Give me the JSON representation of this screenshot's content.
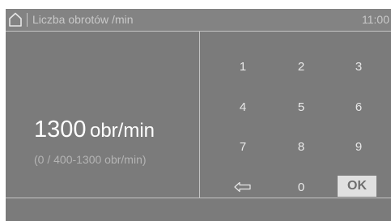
{
  "header": {
    "home_icon": "home-icon",
    "title": "Liczba obrotów /min",
    "clock": "11:00"
  },
  "setting": {
    "value": "1300",
    "unit": "obr/min",
    "range": "(0 / 400-1300 obr/min)"
  },
  "keypad": {
    "keys": [
      "1",
      "2",
      "3",
      "4",
      "5",
      "6",
      "7",
      "8",
      "9"
    ],
    "zero": "0",
    "backspace_icon": "backspace-arrow-icon",
    "ok": "OK"
  },
  "colors": {
    "background": "#7b7b7b",
    "header": "#838383",
    "ok_button": "#e0e0e0"
  }
}
